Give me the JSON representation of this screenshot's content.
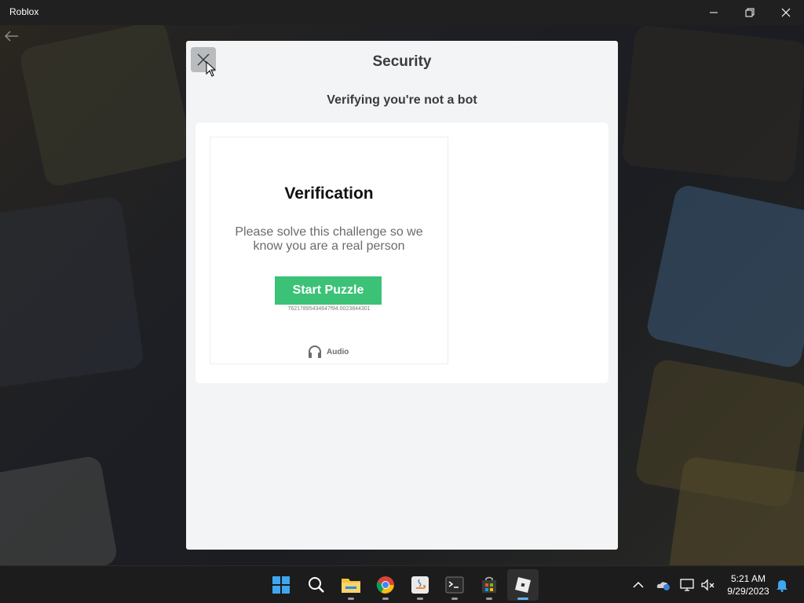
{
  "window": {
    "title": "Roblox",
    "controls": {
      "minimize": "minimize-icon",
      "maximize": "restore-icon",
      "close": "close-icon"
    }
  },
  "modal": {
    "title": "Security",
    "subtitle": "Verifying you're not a bot",
    "close_icon": "close-icon",
    "captcha": {
      "title": "Verification",
      "description": "Please solve this challenge so we know you are a real person",
      "start_button": "Start Puzzle",
      "session_id": "76217895434647f94.0023844301",
      "audio_label": "Audio",
      "button_color": "#3cc276"
    }
  },
  "taskbar": {
    "apps": [
      "windows-start-icon",
      "search-icon",
      "file-explorer-icon",
      "chrome-icon",
      "java-icon",
      "terminal-icon",
      "microsoft-store-icon",
      "roblox-icon"
    ],
    "active_app": "roblox-icon",
    "tray": [
      "chevron-up-icon",
      "onedrive-icon",
      "network-icon",
      "volume-muted-icon",
      "notifications-icon"
    ],
    "time": "5:21 AM",
    "date": "9/29/2023"
  }
}
